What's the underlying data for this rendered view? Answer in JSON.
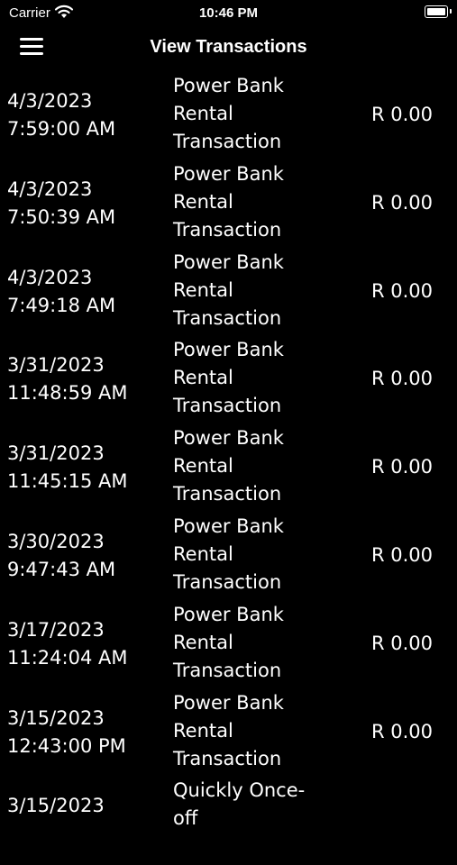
{
  "status_bar": {
    "carrier": "Carrier",
    "time": "10:46 PM"
  },
  "header": {
    "title": "View Transactions"
  },
  "transactions": [
    {
      "date": "4/3/2023",
      "time": "7:59:00 AM",
      "desc1": "Power Bank",
      "desc2": "Rental",
      "desc3": "Transaction",
      "amount": "R 0.00"
    },
    {
      "date": "4/3/2023",
      "time": "7:50:39 AM",
      "desc1": "Power Bank",
      "desc2": "Rental",
      "desc3": "Transaction",
      "amount": "R 0.00"
    },
    {
      "date": "4/3/2023",
      "time": "7:49:18 AM",
      "desc1": "Power Bank",
      "desc2": "Rental",
      "desc3": "Transaction",
      "amount": "R 0.00"
    },
    {
      "date": "3/31/2023",
      "time": "11:48:59 AM",
      "desc1": "Power Bank",
      "desc2": "Rental",
      "desc3": "Transaction",
      "amount": "R 0.00"
    },
    {
      "date": "3/31/2023",
      "time": "11:45:15 AM",
      "desc1": "Power Bank",
      "desc2": "Rental",
      "desc3": "Transaction",
      "amount": "R 0.00"
    },
    {
      "date": "3/30/2023",
      "time": "9:47:43 AM",
      "desc1": "Power Bank",
      "desc2": "Rental",
      "desc3": "Transaction",
      "amount": "R 0.00"
    },
    {
      "date": "3/17/2023",
      "time": "11:24:04 AM",
      "desc1": "Power Bank",
      "desc2": "Rental",
      "desc3": "Transaction",
      "amount": "R 0.00"
    },
    {
      "date": "3/15/2023",
      "time": "12:43:00 PM",
      "desc1": "Power Bank",
      "desc2": "Rental",
      "desc3": "Transaction",
      "amount": "R 0.00"
    },
    {
      "date": "3/15/2023",
      "time": "",
      "desc1": "Quickly Once-off",
      "desc2": "",
      "desc3": "",
      "amount": ""
    }
  ]
}
